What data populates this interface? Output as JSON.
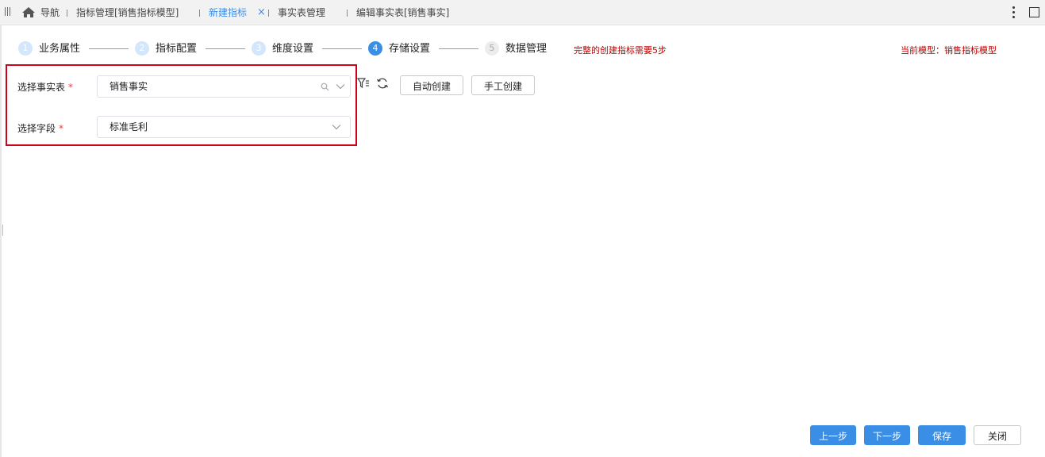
{
  "tabs": {
    "nav": "导航",
    "indicator_mgmt": "指标管理[销售指标模型]",
    "new_indicator": "新建指标",
    "close_glyph": "×",
    "fact_table_mgmt": "事实表管理",
    "edit_fact_table": "编辑事实表[销售事实]"
  },
  "steps": [
    {
      "num": "1",
      "label": "业务属性",
      "state": "done"
    },
    {
      "num": "2",
      "label": "指标配置",
      "state": "done"
    },
    {
      "num": "3",
      "label": "维度设置",
      "state": "done"
    },
    {
      "num": "4",
      "label": "存储设置",
      "state": "active"
    },
    {
      "num": "5",
      "label": "数据管理",
      "state": "todo"
    }
  ],
  "step_hint": "完整的创建指标需要5步",
  "model_info": "当前模型：销售指标模型",
  "form": {
    "fact_table_label": "选择事实表",
    "fact_table_value": "销售事实",
    "field_label": "选择字段",
    "field_value": "标准毛利",
    "required_mark": "*"
  },
  "buttons": {
    "auto_create": "自动创建",
    "manual_create": "手工创建",
    "prev": "上一步",
    "next": "下一步",
    "save": "保存",
    "close": "关闭"
  },
  "colors": {
    "accent": "#3a8ee6",
    "warning_text": "#c00000",
    "highlight_border": "#d0021b"
  }
}
